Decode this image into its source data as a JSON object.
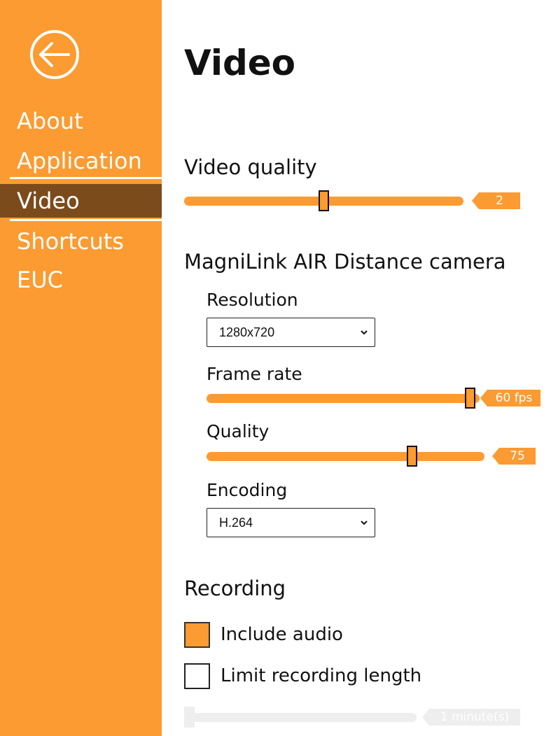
{
  "sidebar": {
    "items": [
      {
        "label": "About"
      },
      {
        "label": "Application"
      },
      {
        "label": "Video"
      },
      {
        "label": "Shortcuts"
      },
      {
        "label": "EUC"
      }
    ],
    "active_item": "Video"
  },
  "main": {
    "title": "Video",
    "video_quality": {
      "label": "Video quality",
      "value": "2",
      "fraction": 0.49
    },
    "camera": {
      "title": "MagniLink AIR Distance camera",
      "resolution": {
        "label": "Resolution",
        "selected": "1280x720"
      },
      "frame_rate": {
        "label": "Frame rate",
        "value": "60 fps",
        "fraction": 1.0
      },
      "quality": {
        "label": "Quality",
        "value": "75",
        "fraction": 0.73
      },
      "encoding": {
        "label": "Encoding",
        "selected": "H.264"
      }
    },
    "recording": {
      "title": "Recording",
      "include_audio": {
        "label": "Include audio",
        "checked": true
      },
      "limit_length": {
        "label": "Limit recording length",
        "checked": false
      },
      "length_slider": {
        "value": "1 minute(s)",
        "fraction": 0.0,
        "enabled": false
      }
    }
  },
  "colors": {
    "accent": "#fb9b31",
    "active_nav": "#7c4b1c",
    "disabled": "#eeeeee"
  },
  "icons": {
    "back": "back-arrow-circle-icon",
    "select_chevron": "chevron-down-icon"
  }
}
